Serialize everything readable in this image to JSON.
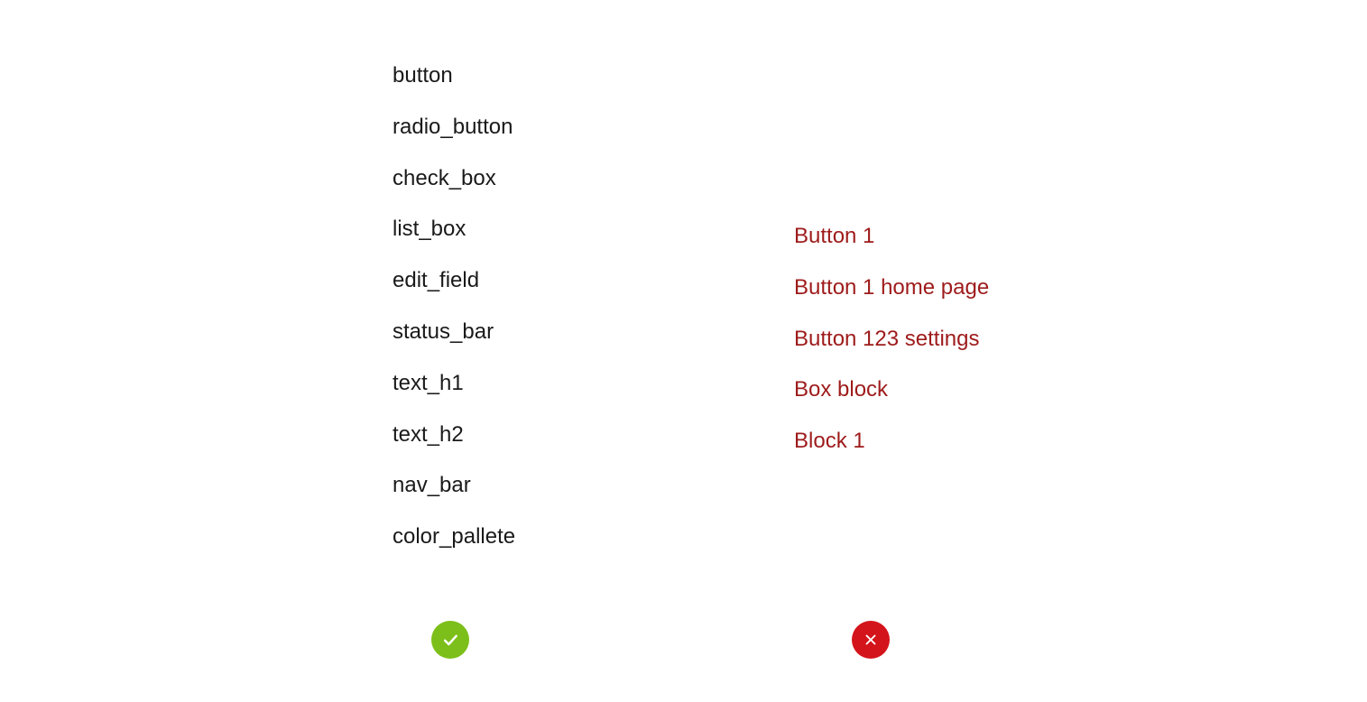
{
  "good_examples": [
    "button",
    "radio_button",
    "check_box",
    "list_box",
    "edit_field",
    "status_bar",
    "text_h1",
    "text_h2",
    "nav_bar",
    "color_pallete"
  ],
  "bad_examples": [
    "Button 1",
    "Button 1 home page",
    "Button 123 settings",
    "Box block",
    "Block 1"
  ],
  "colors": {
    "good_text": "#1a1a1a",
    "bad_text": "#9e1b1b",
    "badge_green": "#7cbf1a",
    "badge_red": "#d4141b"
  }
}
